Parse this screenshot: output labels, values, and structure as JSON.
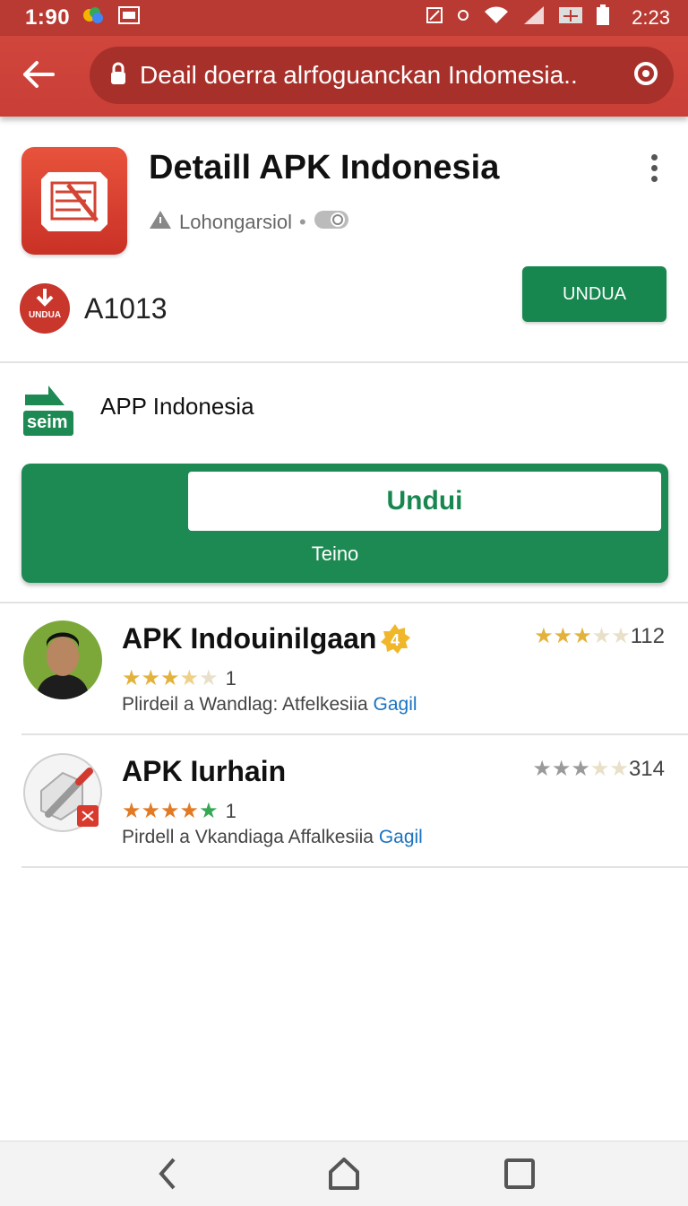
{
  "status_bar": {
    "time_left": "1:90",
    "time_right": "2:23"
  },
  "url_bar": {
    "text": "Deail doerra alrfoguanckan Indomesia.."
  },
  "app": {
    "title": "Detaill APK Indonesia",
    "developer": "Lohongarsiol",
    "badge_label": "UNDUA",
    "downloads": "A1013",
    "install_label": "UNDUA"
  },
  "promo": {
    "logo_text": "seim",
    "title": "APP Indonesia",
    "button_label": "Undui",
    "subtitle": "Teino"
  },
  "list": [
    {
      "title": "APK Indouinilgaan",
      "badge": "4",
      "stars": 3.5,
      "star_count": "1",
      "desc": "Plirdeil a Wandlag: Atfelkesiia",
      "link": "Gagil",
      "rating_stars": 3,
      "rating_count": "112"
    },
    {
      "title": "APK Iurhain",
      "stars": 5,
      "star_count": "1",
      "desc": "Pirdell a Vkandiaga Affalkesiia",
      "link": "Gagil",
      "rating_stars": 3,
      "rating_count": "314"
    }
  ],
  "colors": {
    "brand_red": "#c93f37",
    "brand_green": "#17874f",
    "star_gold": "#e3b23c"
  }
}
